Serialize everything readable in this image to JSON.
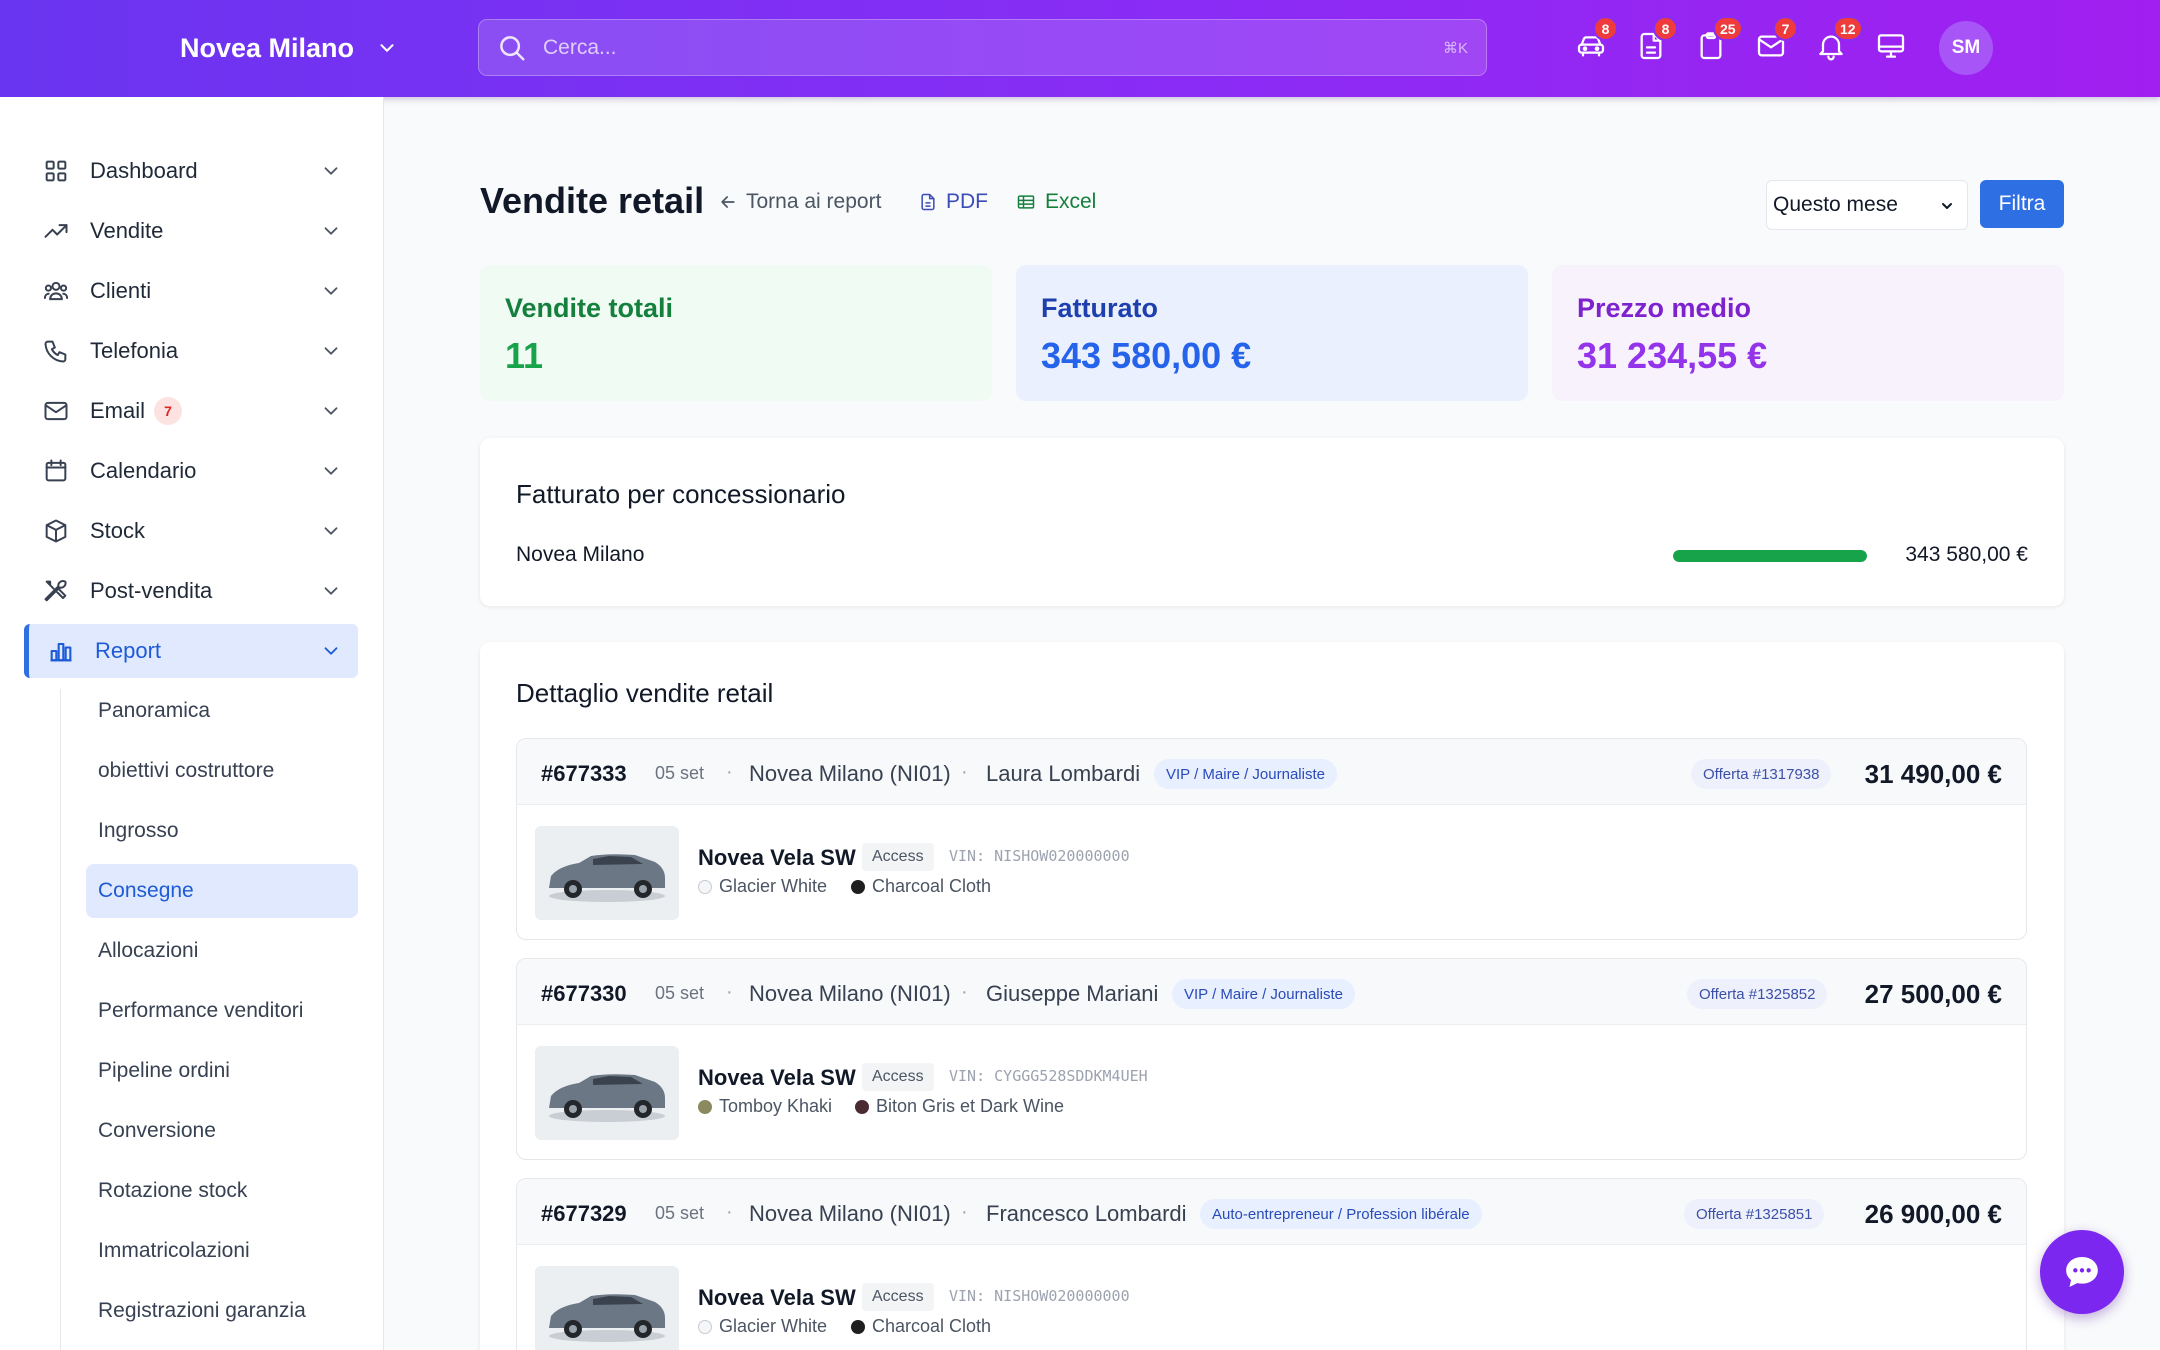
{
  "header": {
    "brand": "Novea Milano",
    "search_placeholder": "Cerca...",
    "search_shortcut": "⌘K",
    "badges": {
      "cars": "8",
      "documents": "8",
      "clipboard": "25",
      "mail": "7",
      "bell": "12"
    },
    "avatar_initials": "SM"
  },
  "sidebar": {
    "items": [
      {
        "label": "Dashboard"
      },
      {
        "label": "Vendite"
      },
      {
        "label": "Clienti"
      },
      {
        "label": "Telefonia"
      },
      {
        "label": "Email",
        "badge": "7"
      },
      {
        "label": "Calendario"
      },
      {
        "label": "Stock"
      },
      {
        "label": "Post-vendita"
      },
      {
        "label": "Report"
      }
    ],
    "subitems": [
      "Panoramica",
      "obiettivi costruttore",
      "Ingrosso",
      "Consegne",
      "Allocazioni",
      "Performance venditori",
      "Pipeline ordini",
      "Conversione",
      "Rotazione stock",
      "Immatricolazioni",
      "Registrazioni garanzia"
    ]
  },
  "main": {
    "title": "Vendite retail",
    "back_link": "Torna ai report",
    "pdf_link": "PDF",
    "excel_link": "Excel",
    "period_select": "Questo mese",
    "filter_button": "Filtra",
    "stats": [
      {
        "label": "Vendite totali",
        "value": "11"
      },
      {
        "label": "Fatturato",
        "value": "343 580,00 €"
      },
      {
        "label": "Prezzo medio",
        "value": "31 234,55 €"
      }
    ],
    "revenue_by_dealer": {
      "title": "Fatturato per concessionario",
      "rows": [
        {
          "dealer": "Novea Milano",
          "amount": "343 580,00 €",
          "share": 1.0
        }
      ]
    },
    "detail": {
      "title": "Dettaglio vendite retail",
      "orders": [
        {
          "id": "#677333",
          "date": "05 set",
          "sep": "·",
          "dealer": "Novea Milano (NI01)",
          "customer": "Laura Lombardi",
          "tag": "VIP / Maire / Journaliste",
          "offer": "Offerta #1317938",
          "price": "31 490,00 €",
          "model": "Novea Vela SW",
          "trim": "Access",
          "vin": "VIN: NISHOW020000000",
          "ext_color": "Glacier White",
          "int_color": "Charcoal Cloth",
          "ext_swatch": "#f5f6f7",
          "int_swatch": "#1f1f1f"
        },
        {
          "id": "#677330",
          "date": "05 set",
          "sep": "·",
          "dealer": "Novea Milano (NI01)",
          "customer": "Giuseppe Mariani",
          "tag": "VIP / Maire / Journaliste",
          "offer": "Offerta #1325852",
          "price": "27 500,00 €",
          "model": "Novea Vela SW",
          "trim": "Access",
          "vin": "VIN: CYGGG528SDDKM4UEH",
          "ext_color": "Tomboy Khaki",
          "int_color": "Biton Gris et Dark Wine",
          "ext_swatch": "#8b8a5f",
          "int_swatch": "#4a2b32"
        },
        {
          "id": "#677329",
          "date": "05 set",
          "sep": "·",
          "dealer": "Novea Milano (NI01)",
          "customer": "Francesco Lombardi",
          "tag": "Auto-entrepreneur / Profession libérale",
          "offer": "Offerta #1325851",
          "price": "26 900,00 €",
          "model": "Novea Vela SW",
          "trim": "Access",
          "vin": "VIN: NISHOW020000000",
          "ext_color": "Glacier White",
          "int_color": "Charcoal Cloth",
          "ext_swatch": "#f5f6f7",
          "int_swatch": "#1f1f1f"
        }
      ]
    }
  },
  "colors": {
    "header_gradient_start": "#6a35f0",
    "header_gradient_end": "#a11ff0",
    "accent_blue": "#2f6fe4",
    "stat_green": "#15803d",
    "stat_blue": "#1d4ed8",
    "stat_purple": "#9333ea",
    "progress_green": "#16a34a"
  }
}
